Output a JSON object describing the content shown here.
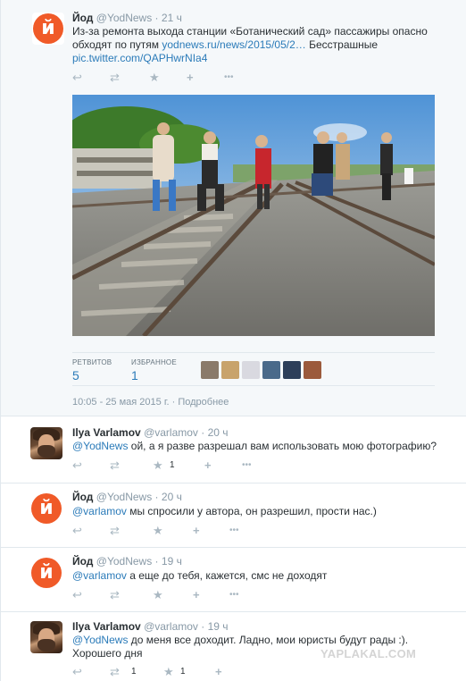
{
  "main": {
    "name": "Йод",
    "handle": "@YodNews",
    "time": "21 ч",
    "text_l1": "Из-за ремонта выхода станции «Ботанический сад» пассажиры опасно",
    "text_l2a": "обходят по путям ",
    "link1": "yodnews.ru/news/2015/05/2…",
    "text_l2b": " Бесстрашные",
    "link2": "pic.twitter.com/QAPHwrNIa4",
    "retweets_label": "РЕТВИТОВ",
    "retweets": "5",
    "favs_label": "ИЗБРАННОЕ",
    "favs": "1",
    "timestamp": "10:05 - 25 мая 2015 г.",
    "details_sep": " · ",
    "details": "Подробнее",
    "avatar_letter": "й"
  },
  "replies": [
    {
      "name": "Ilya Varlamov",
      "handle": "@varlamov",
      "time": "20 ч",
      "mention": "@YodNews",
      "text": " ой, а я разве разрешал вам использовать мою фотографию?",
      "fav_count": "1"
    },
    {
      "name": "Йод",
      "handle": "@YodNews",
      "time": "20 ч",
      "mention": "@varlamov",
      "text": " мы спросили у автора, он разрешил, прости нас.)",
      "avatar_letter": "й"
    },
    {
      "name": "Йод",
      "handle": "@YodNews",
      "time": "19 ч",
      "mention": "@varlamov",
      "text": " а еще до тебя, кажется, смс не доходят",
      "avatar_letter": "й"
    },
    {
      "name": "Ilya Varlamov",
      "handle": "@varlamov",
      "time": "19 ч",
      "mention": "@YodNews",
      "text": " до меня все доходит. Ладно, мои юристы будут рады :).",
      "text2": "Хорошего дня",
      "rt_count": "1",
      "fav_count": "1"
    }
  ],
  "icons": {
    "reply": "↩",
    "retweet": "⇄",
    "favorite": "★",
    "follow": "+",
    "more": "•••"
  },
  "watermark": "YAPLAKAL.COM",
  "colors": {
    "link": "#2b7bb9",
    "yod_orange": "#f05a28",
    "muted": "#8899a6",
    "icon": "#aab8c2"
  }
}
